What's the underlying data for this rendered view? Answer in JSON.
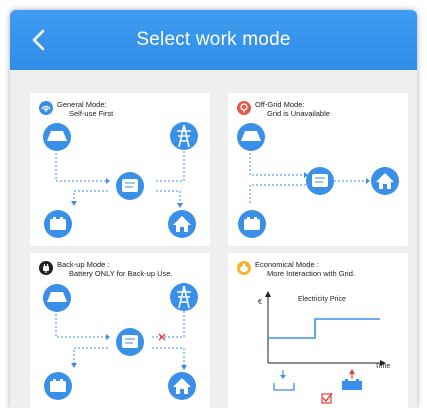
{
  "header": {
    "title": "Select work mode"
  },
  "modes": [
    {
      "title": "General Mode:",
      "subtitle": "Self-use First"
    },
    {
      "title": "Off-Grid Mode:",
      "subtitle": "Grid is Unavailable"
    },
    {
      "title": "Back-up Mode :",
      "subtitle": "Battery ONLY for Back-up Use."
    },
    {
      "title": "Economical Mode :",
      "subtitle": "More Interaction with Grid."
    }
  ],
  "economical_chart": {
    "title": "Electricity Price",
    "y_axis_label": "€",
    "x_axis_label": "Time"
  },
  "colors": {
    "header": "#2f8de8",
    "accent": "#3a8fe8",
    "red": "#e23b3b",
    "yellow": "#f2b52c"
  },
  "icons": [
    "back-chevron-icon",
    "solar-panel-icon",
    "grid-tower-icon",
    "inverter-icon",
    "battery-icon",
    "home-icon"
  ]
}
